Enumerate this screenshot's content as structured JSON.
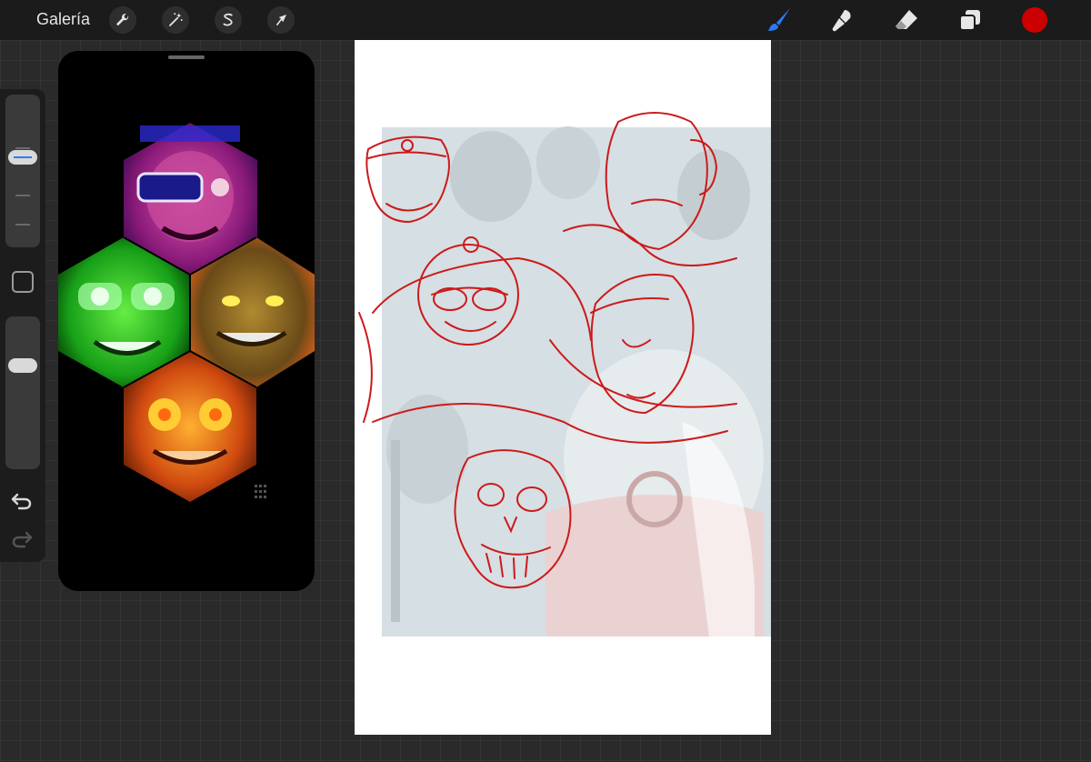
{
  "toolbar": {
    "gallery_label": "Galería",
    "left_icons": [
      "wrench-icon",
      "magic-wand-icon",
      "selection-s-icon",
      "move-arrow-icon"
    ],
    "right_icons": [
      "brush-icon",
      "smudge-icon",
      "eraser-icon",
      "layers-icon"
    ],
    "active_tool": "brush",
    "current_color": "#cc0000",
    "accent_color": "#2c7bf0"
  },
  "sidebar": {
    "brush_size_level": 0.6,
    "brush_opacity_level": 0.7,
    "icons": [
      "modify-square-icon",
      "undo-icon",
      "redo-icon"
    ]
  },
  "reference": {
    "window_background": "#000000",
    "hex_colors": [
      "#b0288c",
      "#22c828",
      "#c05a18",
      "#e0701a"
    ]
  },
  "canvas": {
    "background": "#ffffff",
    "sketch_color": "#cc1a1a"
  }
}
